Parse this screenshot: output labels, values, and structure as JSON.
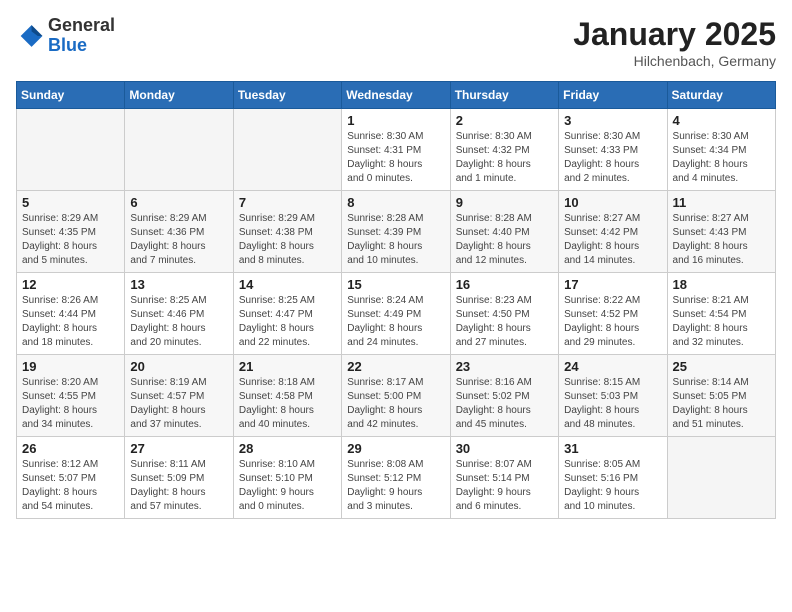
{
  "header": {
    "logo_general": "General",
    "logo_blue": "Blue",
    "month": "January 2025",
    "location": "Hilchenbach, Germany"
  },
  "weekdays": [
    "Sunday",
    "Monday",
    "Tuesday",
    "Wednesday",
    "Thursday",
    "Friday",
    "Saturday"
  ],
  "weeks": [
    [
      {
        "day": "",
        "info": ""
      },
      {
        "day": "",
        "info": ""
      },
      {
        "day": "",
        "info": ""
      },
      {
        "day": "1",
        "info": "Sunrise: 8:30 AM\nSunset: 4:31 PM\nDaylight: 8 hours\nand 0 minutes."
      },
      {
        "day": "2",
        "info": "Sunrise: 8:30 AM\nSunset: 4:32 PM\nDaylight: 8 hours\nand 1 minute."
      },
      {
        "day": "3",
        "info": "Sunrise: 8:30 AM\nSunset: 4:33 PM\nDaylight: 8 hours\nand 2 minutes."
      },
      {
        "day": "4",
        "info": "Sunrise: 8:30 AM\nSunset: 4:34 PM\nDaylight: 8 hours\nand 4 minutes."
      }
    ],
    [
      {
        "day": "5",
        "info": "Sunrise: 8:29 AM\nSunset: 4:35 PM\nDaylight: 8 hours\nand 5 minutes."
      },
      {
        "day": "6",
        "info": "Sunrise: 8:29 AM\nSunset: 4:36 PM\nDaylight: 8 hours\nand 7 minutes."
      },
      {
        "day": "7",
        "info": "Sunrise: 8:29 AM\nSunset: 4:38 PM\nDaylight: 8 hours\nand 8 minutes."
      },
      {
        "day": "8",
        "info": "Sunrise: 8:28 AM\nSunset: 4:39 PM\nDaylight: 8 hours\nand 10 minutes."
      },
      {
        "day": "9",
        "info": "Sunrise: 8:28 AM\nSunset: 4:40 PM\nDaylight: 8 hours\nand 12 minutes."
      },
      {
        "day": "10",
        "info": "Sunrise: 8:27 AM\nSunset: 4:42 PM\nDaylight: 8 hours\nand 14 minutes."
      },
      {
        "day": "11",
        "info": "Sunrise: 8:27 AM\nSunset: 4:43 PM\nDaylight: 8 hours\nand 16 minutes."
      }
    ],
    [
      {
        "day": "12",
        "info": "Sunrise: 8:26 AM\nSunset: 4:44 PM\nDaylight: 8 hours\nand 18 minutes."
      },
      {
        "day": "13",
        "info": "Sunrise: 8:25 AM\nSunset: 4:46 PM\nDaylight: 8 hours\nand 20 minutes."
      },
      {
        "day": "14",
        "info": "Sunrise: 8:25 AM\nSunset: 4:47 PM\nDaylight: 8 hours\nand 22 minutes."
      },
      {
        "day": "15",
        "info": "Sunrise: 8:24 AM\nSunset: 4:49 PM\nDaylight: 8 hours\nand 24 minutes."
      },
      {
        "day": "16",
        "info": "Sunrise: 8:23 AM\nSunset: 4:50 PM\nDaylight: 8 hours\nand 27 minutes."
      },
      {
        "day": "17",
        "info": "Sunrise: 8:22 AM\nSunset: 4:52 PM\nDaylight: 8 hours\nand 29 minutes."
      },
      {
        "day": "18",
        "info": "Sunrise: 8:21 AM\nSunset: 4:54 PM\nDaylight: 8 hours\nand 32 minutes."
      }
    ],
    [
      {
        "day": "19",
        "info": "Sunrise: 8:20 AM\nSunset: 4:55 PM\nDaylight: 8 hours\nand 34 minutes."
      },
      {
        "day": "20",
        "info": "Sunrise: 8:19 AM\nSunset: 4:57 PM\nDaylight: 8 hours\nand 37 minutes."
      },
      {
        "day": "21",
        "info": "Sunrise: 8:18 AM\nSunset: 4:58 PM\nDaylight: 8 hours\nand 40 minutes."
      },
      {
        "day": "22",
        "info": "Sunrise: 8:17 AM\nSunset: 5:00 PM\nDaylight: 8 hours\nand 42 minutes."
      },
      {
        "day": "23",
        "info": "Sunrise: 8:16 AM\nSunset: 5:02 PM\nDaylight: 8 hours\nand 45 minutes."
      },
      {
        "day": "24",
        "info": "Sunrise: 8:15 AM\nSunset: 5:03 PM\nDaylight: 8 hours\nand 48 minutes."
      },
      {
        "day": "25",
        "info": "Sunrise: 8:14 AM\nSunset: 5:05 PM\nDaylight: 8 hours\nand 51 minutes."
      }
    ],
    [
      {
        "day": "26",
        "info": "Sunrise: 8:12 AM\nSunset: 5:07 PM\nDaylight: 8 hours\nand 54 minutes."
      },
      {
        "day": "27",
        "info": "Sunrise: 8:11 AM\nSunset: 5:09 PM\nDaylight: 8 hours\nand 57 minutes."
      },
      {
        "day": "28",
        "info": "Sunrise: 8:10 AM\nSunset: 5:10 PM\nDaylight: 9 hours\nand 0 minutes."
      },
      {
        "day": "29",
        "info": "Sunrise: 8:08 AM\nSunset: 5:12 PM\nDaylight: 9 hours\nand 3 minutes."
      },
      {
        "day": "30",
        "info": "Sunrise: 8:07 AM\nSunset: 5:14 PM\nDaylight: 9 hours\nand 6 minutes."
      },
      {
        "day": "31",
        "info": "Sunrise: 8:05 AM\nSunset: 5:16 PM\nDaylight: 9 hours\nand 10 minutes."
      },
      {
        "day": "",
        "info": ""
      }
    ]
  ]
}
